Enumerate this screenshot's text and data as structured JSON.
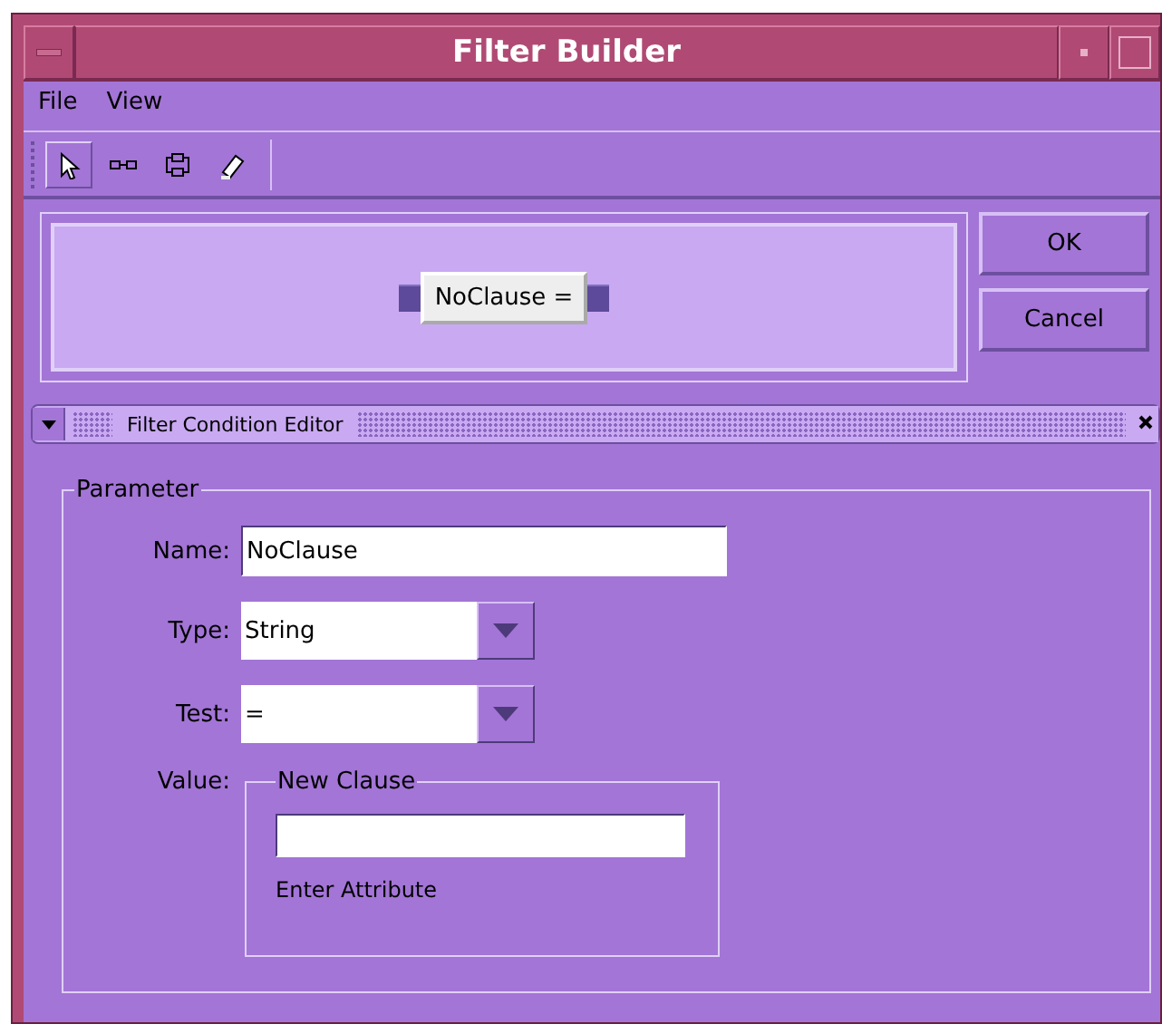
{
  "window": {
    "title": "Filter Builder"
  },
  "menu": [
    {
      "label": "File"
    },
    {
      "label": "View"
    }
  ],
  "toolbar": [
    {
      "kind": "pointer",
      "selected": true
    },
    {
      "kind": "link",
      "selected": false
    },
    {
      "kind": "node",
      "selected": false
    },
    {
      "kind": "eraser",
      "selected": false
    }
  ],
  "canvas": {
    "node": "NoClause ="
  },
  "buttons": [
    "OK",
    "Cancel"
  ],
  "editor": {
    "title": "Filter Condition Editor",
    "expanded": true
  },
  "parameter": {
    "title": "Parameter",
    "fields": [
      {
        "kind": "text",
        "label": "Name:",
        "value": "NoClause"
      },
      {
        "kind": "combo",
        "label": "Type:",
        "value": "String"
      },
      {
        "kind": "combo",
        "label": "Test:",
        "value": "="
      }
    ],
    "value": {
      "label": "Value:",
      "group": "New Clause",
      "hint": "Enter Attribute"
    }
  }
}
